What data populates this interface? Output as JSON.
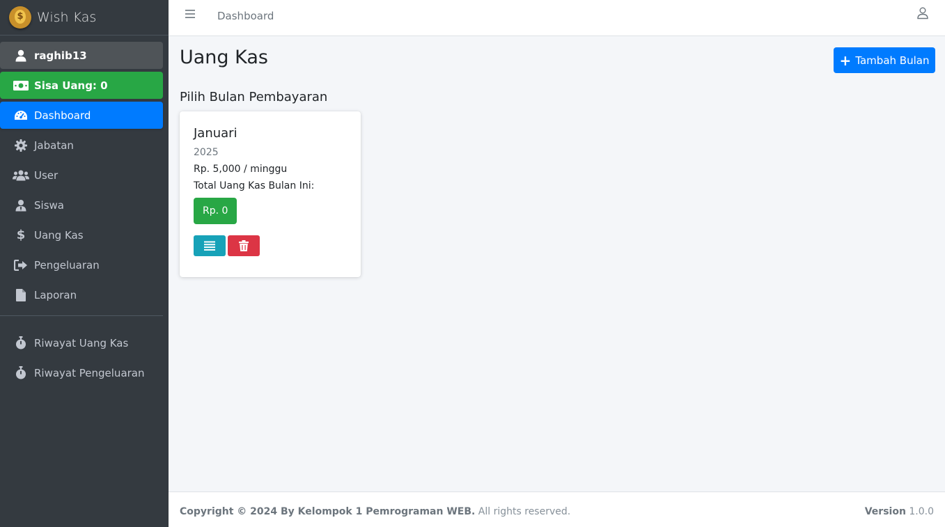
{
  "brand": {
    "name": "Wish Kas"
  },
  "sidebar": {
    "user": "raghib13",
    "balance": "Sisa Uang: 0",
    "items": [
      {
        "label": "Dashboard",
        "icon": "dashboard-icon"
      },
      {
        "label": "Jabatan",
        "icon": "gear-icon"
      },
      {
        "label": "User",
        "icon": "users-icon"
      },
      {
        "label": "Siswa",
        "icon": "student-icon"
      },
      {
        "label": "Uang Kas",
        "icon": "dollar-icon"
      },
      {
        "label": "Pengeluaran",
        "icon": "sign-out-icon"
      },
      {
        "label": "Laporan",
        "icon": "file-icon"
      }
    ],
    "history": [
      {
        "label": "Riwayat Uang Kas",
        "icon": "stopwatch-icon"
      },
      {
        "label": "Riwayat Pengeluaran",
        "icon": "stopwatch-icon"
      }
    ]
  },
  "topbar": {
    "breadcrumb": "Dashboard"
  },
  "main": {
    "title": "Uang Kas",
    "add_button": "Tambah Bulan",
    "section_title": "Pilih Bulan Pembayaran",
    "cards": [
      {
        "month": "Januari",
        "year": "2025",
        "rate": "Rp. 5,000 / minggu",
        "total_label": "Total Uang Kas Bulan Ini:",
        "total_value": "Rp. 0"
      }
    ]
  },
  "footer": {
    "copyright": "Copyright © 2024 By Kelompok 1 Pemrograman WEB.",
    "rights": " All rights reserved.",
    "version_label": "Version",
    "version_value": " 1.0.0"
  },
  "colors": {
    "sidebar": "#343a40",
    "primary": "#007bff",
    "success": "#28a745",
    "info": "#17a2b8",
    "danger": "#dc3545"
  }
}
